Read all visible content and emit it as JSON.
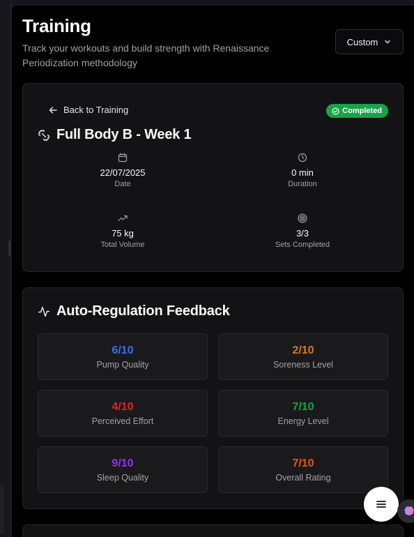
{
  "header": {
    "title": "Training",
    "subtitle": "Track your workouts and build strength with Renaissance Periodization methodology",
    "mode_button": "Custom"
  },
  "workout": {
    "back_label": "Back to Training",
    "status": "Completed",
    "title": "Full Body B - Week 1",
    "stats": [
      {
        "icon": "calendar-icon",
        "value": "22/07/2025",
        "label": "Date"
      },
      {
        "icon": "clock-icon",
        "value": "0 min",
        "label": "Duration"
      },
      {
        "icon": "trending-up-icon",
        "value": "75 kg",
        "label": "Total Volume"
      },
      {
        "icon": "target-icon",
        "value": "3/3",
        "label": "Sets Completed"
      }
    ]
  },
  "feedback": {
    "title": "Auto-Regulation Feedback",
    "items": [
      {
        "score": "6/10",
        "label": "Pump Quality",
        "color": "#3b6cf0"
      },
      {
        "score": "2/10",
        "label": "Soreness Level",
        "color": "#d97a1c"
      },
      {
        "score": "4/10",
        "label": "Perceived Effort",
        "color": "#dc2626"
      },
      {
        "score": "7/10",
        "label": "Energy Level",
        "color": "#16a34a"
      },
      {
        "score": "9/10",
        "label": "Sleep Quality",
        "color": "#9333ea"
      },
      {
        "score": "7/10",
        "label": "Overall Rating",
        "color": "#ea580c"
      }
    ]
  },
  "colors": {
    "completed_badge": "#16a34a",
    "background": "#000000",
    "card": "#131315"
  },
  "icons": {
    "fab": "menu-icon",
    "assistant": "brain-icon"
  }
}
